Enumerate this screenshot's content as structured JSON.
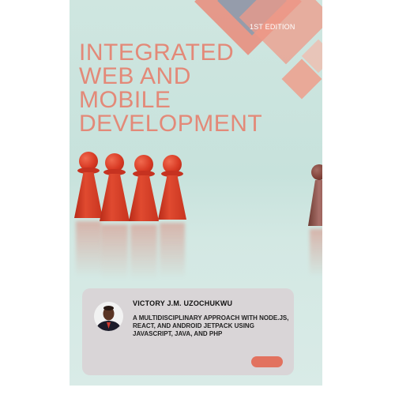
{
  "book": {
    "edition": "1ST EDITION",
    "title_lines": [
      "INTEGRATED",
      "WEB AND",
      "MOBILE",
      "DEVELOPMENT"
    ],
    "author": "VICTORY J.M. UZOCHUKWU",
    "subtitle": "A MULTIDISCIPLINARY APPROACH WITH NODE.JS, REACT, AND ANDROID JETPACK USING JAVASCRIPT, JAVA, AND PHP"
  },
  "colors": {
    "background": "#cfe6e0",
    "title": "#e38978",
    "accent": "#e2725f",
    "pawn": "#d83a24",
    "card": "#d9d2d6"
  }
}
